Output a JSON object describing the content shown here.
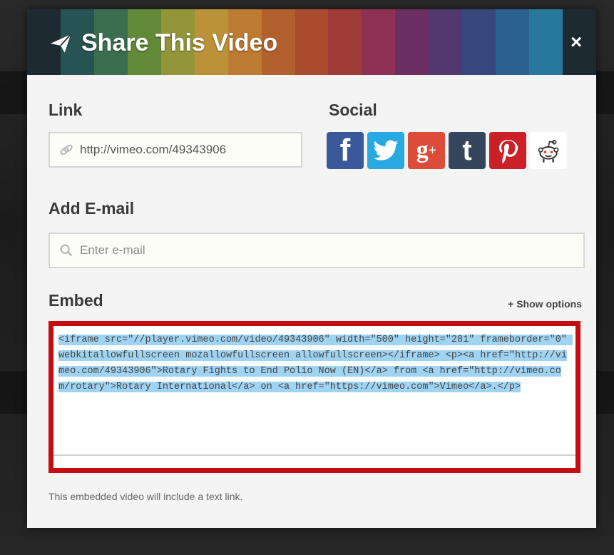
{
  "modal": {
    "title": "Share This Video",
    "close_label": "×"
  },
  "link": {
    "label": "Link",
    "value": "http://vimeo.com/49343906"
  },
  "social": {
    "label": "Social",
    "icons": [
      "facebook-icon",
      "twitter-icon",
      "google-plus-icon",
      "tumblr-icon",
      "pinterest-icon",
      "reddit-icon"
    ]
  },
  "email": {
    "label": "Add E-mail",
    "placeholder": "Enter e-mail"
  },
  "embed": {
    "label": "Embed",
    "show_options": "+ Show options",
    "code": "<iframe src=\"//player.vimeo.com/video/49343906\" width=\"500\" height=\"281\" frameborder=\"0\" webkitallowfullscreen mozallowfullscreen allowfullscreen></iframe> <p><a href=\"http://vimeo.com/49343906\">Rotary Fights to End Polio Now (EN)</a> from <a href=\"http://vimeo.com/rotary\">Rotary International</a> on <a href=\"https://vimeo.com\">Vimeo</a>.</p>",
    "note": "This embedded video will include a text link."
  },
  "colors": {
    "highlight_border": "#c50e14",
    "selection": "#9fd3f2",
    "stripes": [
      "#1f2a33",
      "#2a5a5a",
      "#3f7a55",
      "#6f9a3a",
      "#a7a83a",
      "#d7a53a",
      "#d98a33",
      "#cc6a2e",
      "#c2542e",
      "#b63f3a",
      "#a3335a",
      "#7a2f6a",
      "#5a3b7a",
      "#3b4c8a",
      "#2d6aa0",
      "#2a86b0",
      "#1f2a33"
    ]
  }
}
